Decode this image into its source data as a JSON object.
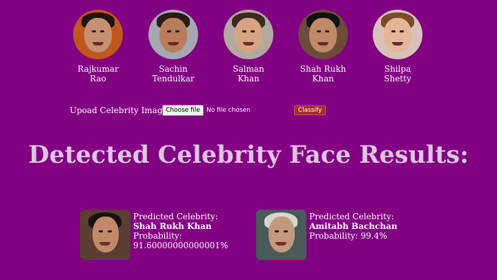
{
  "celebrities": [
    {
      "line1": "Rajkumar",
      "line2": "Rao",
      "bg": "#c0571c",
      "skin": "#c59172",
      "hair": "#1d1510"
    },
    {
      "line1": "Sachin",
      "line2": "Tendulkar",
      "bg": "#a5a7b3",
      "skin": "#b97d5c",
      "hair": "#2a1c14"
    },
    {
      "line1": "Salman",
      "line2": "Khan",
      "bg": "#b3a89f",
      "skin": "#d6a482",
      "hair": "#3b2a20"
    },
    {
      "line1": "Shah Rukh",
      "line2": "Khan",
      "bg": "#6e4a3a",
      "skin": "#bf8a68",
      "hair": "#121010"
    },
    {
      "line1": "Shilpa",
      "line2": "Shetty",
      "bg": "#d8c2b8",
      "skin": "#e5b597",
      "hair": "#7a4a2a"
    }
  ],
  "upload": {
    "label": "Upoad Celebrity Image:",
    "choose_button": "Choose file",
    "file_status": "No file chosen",
    "classify_button": "Classify"
  },
  "results_title": "Detected Celebrity Face Results:",
  "results": [
    {
      "label": "Predicted Celebrity:",
      "name": "Shah Rukh Khan",
      "probability_label": "Probability:",
      "probability": "91.60000000000001%",
      "bg": "#5a3d33",
      "skin": "#c08a6a",
      "hair": "#1a1210"
    },
    {
      "label": "Predicted Celebrity:",
      "name": "Amitabh Bachchan",
      "probability_label": "Probability:",
      "probability": "99.4%",
      "bg": "#4a5a58",
      "skin": "#c4987c",
      "hair": "#d8d4cf"
    }
  ]
}
